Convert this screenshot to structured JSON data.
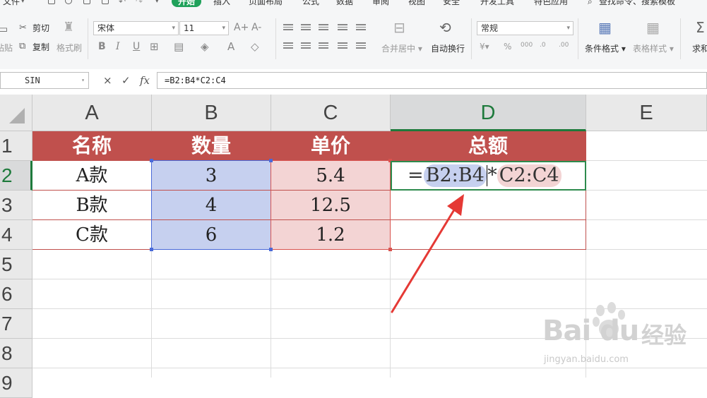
{
  "menu": {
    "file": "文件",
    "tabs": [
      "开始",
      "插入",
      "页面布局",
      "公式",
      "数据",
      "审阅",
      "视图",
      "安全",
      "开发工具",
      "特色应用"
    ],
    "active_tab": "开始",
    "search": "查找命令、搜索模板"
  },
  "ribbon": {
    "cut": "剪切",
    "paste": "粘贴",
    "copy": "复制",
    "format_painter": "格式刷",
    "font_name": "宋体",
    "font_size": "11",
    "font_grow": "A+",
    "font_shrink": "A-",
    "bold": "B",
    "italic": "I",
    "underline": "U",
    "merge_center": "合并居中",
    "wrap_text": "自动换行",
    "number_format": "常规",
    "conditional_format": "条件格式",
    "table_style": "表格样式",
    "sum": "求和"
  },
  "formula_bar": {
    "name_box": "SIN",
    "cancel": "×",
    "confirm": "✓",
    "fx": "fx",
    "formula": "=B2:B4*C2:C4"
  },
  "sheet": {
    "columns": [
      "A",
      "B",
      "C",
      "D",
      "E"
    ],
    "selected_column": "D",
    "rows": [
      "1",
      "2",
      "3",
      "4",
      "5",
      "6",
      "7",
      "8",
      "9"
    ],
    "selected_row": "2",
    "header_row": [
      "名称",
      "数量",
      "单价",
      "总额"
    ],
    "data_rows": [
      [
        "A款",
        "3",
        "5.4",
        ""
      ],
      [
        "B款",
        "4",
        "12.5",
        ""
      ],
      [
        "C款",
        "6",
        "1.2",
        ""
      ]
    ],
    "edit_cell": {
      "equals": "=",
      "ref1": "B2:B4",
      "op": "*",
      "ref2": "C2:C4"
    }
  },
  "colors": {
    "header_fill": "#c0504d",
    "range1": "#c6d0ef",
    "range2": "#f3d4d4",
    "accent_green": "#1fa15a",
    "arrow": "#e53935"
  },
  "watermark": {
    "brand": "Bai du",
    "cn": "经验",
    "url": "jingyan.baidu.com"
  }
}
